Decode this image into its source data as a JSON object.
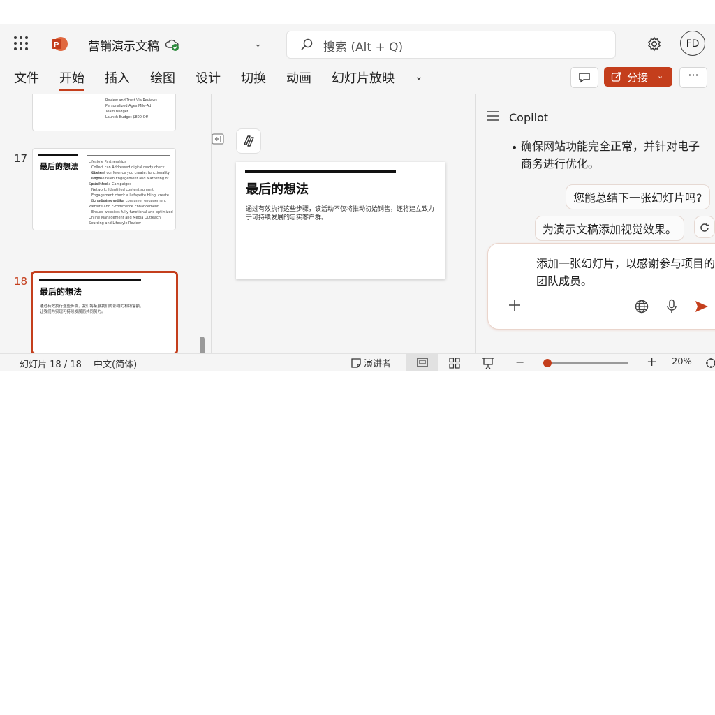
{
  "colors": {
    "accent": "#c43e1c",
    "background": "#f5f5f5"
  },
  "titlebar": {
    "app_icon": "powerpoint-icon",
    "doc_title": "营销演示文稿",
    "saved_icon": "cloud-saved-icon",
    "search_placeholder": "搜索 (Alt + Q)",
    "avatar_initials": "FD"
  },
  "ribbon": {
    "tabs": [
      "文件",
      "开始",
      "插入",
      "绘图",
      "设计",
      "切换",
      "动画",
      "幻灯片放映"
    ],
    "active_tab": "开始",
    "share_label": "分接",
    "more_label": "···"
  },
  "thumbnails": {
    "items": [
      {
        "number": "",
        "lines": [
          "Review and Trust Via Reviews",
          "Personalized Ages Mile-Ad",
          "Team Budget",
          "Launch Budget $800 Off"
        ]
      },
      {
        "number": "17",
        "title": "最后的想法",
        "lines": [
          "Lifestyle Partnerships",
          "Collect can Addressed digital ready check where",
          "Content conference you create: functionality aligns",
          "Choose team Engagement and Marketing of purchase",
          "Social Media Campaigns",
          "Network: Identified content summit",
          "Engagement check a Lafayette bling, create contributing action",
          "Schedule event for consumer engagement",
          "Website and E-commerce Enhancement",
          "Ensure websites fully functional and optimized",
          "Online Management and Media Outreach",
          "Sourcing and Lifestyle Review"
        ]
      },
      {
        "number": "18",
        "title": "最后的想法",
        "body": "通过有效执行这些步骤，我们将拓展我们的影响力和销售额，让我们为实现可持续发展而共同努力。"
      }
    ]
  },
  "slide": {
    "title": "最后的想法",
    "body": "通过有效执行这些步骤，该活动不仅将推动初始销售，还将建立致力于可持续发展的忠实客户群。"
  },
  "copilot": {
    "title": "Copilot",
    "bullet": "确保网站功能完全正常，并针对电子商务进行优化。",
    "suggestions": [
      "您能总结下一张幻灯片吗?",
      "为演示文稿添加视觉效果。"
    ],
    "composer_text": "添加一张幻灯片，以感谢参与项目的团队成员。"
  },
  "statusbar": {
    "slide_count": "幻灯片 18 / 18",
    "language": "中文(简体)",
    "notes_label": "演讲者",
    "zoom": "20%",
    "zoom_level": 0.05
  }
}
